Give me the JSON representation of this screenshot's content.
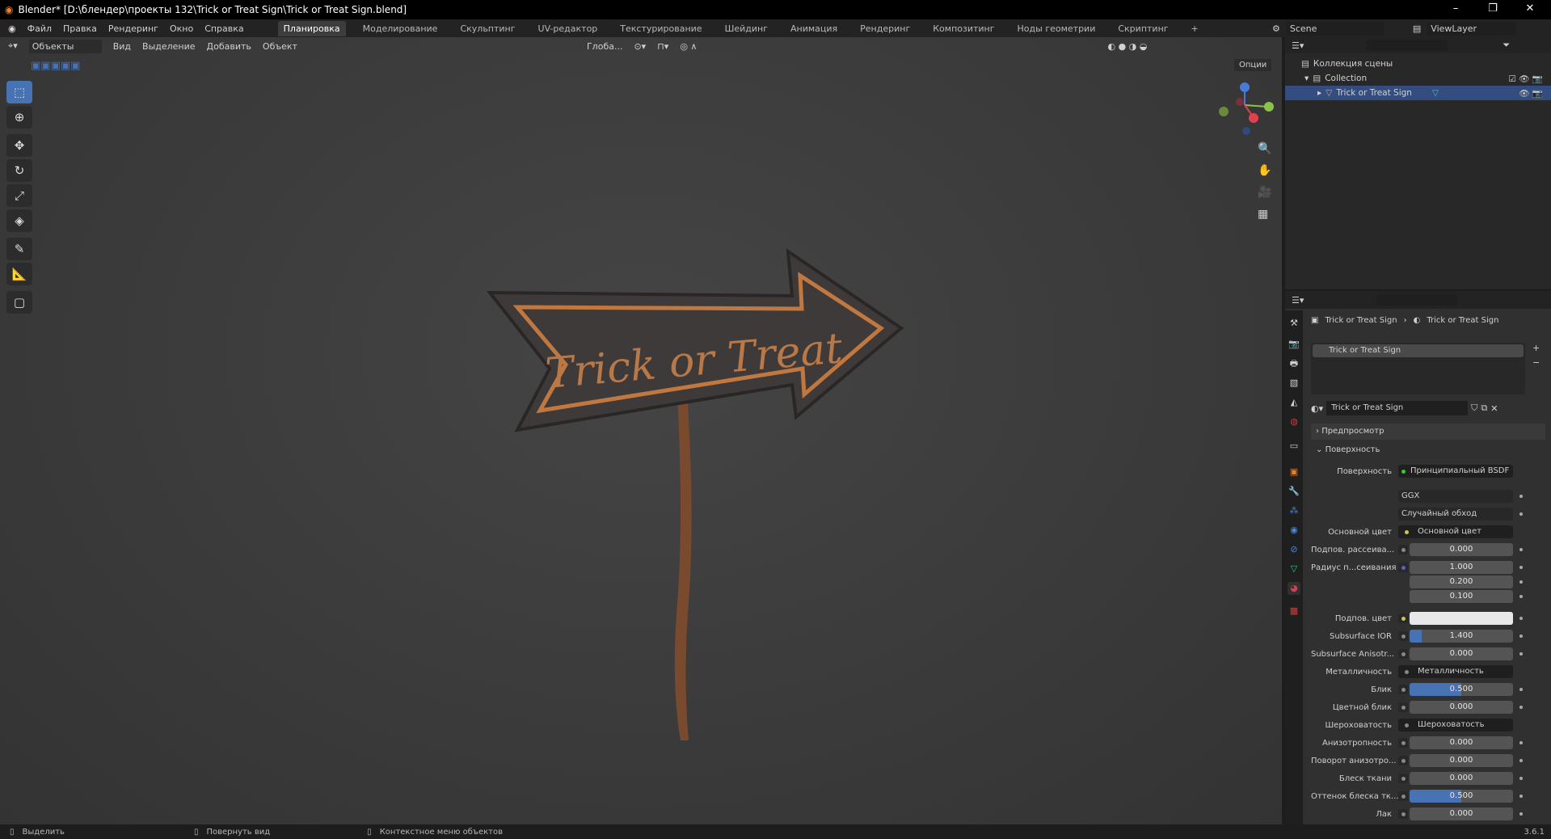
{
  "window": {
    "title": "Blender* [D:\\блендер\\проекты 132\\Trick or Treat Sign\\Trick or Treat Sign.blend]",
    "min": "–",
    "max": "❐",
    "close": "✕"
  },
  "menu": [
    "Файл",
    "Правка",
    "Рендеринг",
    "Окно",
    "Справка"
  ],
  "workspaces": [
    "Планировка",
    "Моделирование",
    "Скульптинг",
    "UV-редактор",
    "Текстурирование",
    "Шейдинг",
    "Анимация",
    "Рендеринг",
    "Композитинг",
    "Ноды геометрии",
    "Скриптинг",
    "+"
  ],
  "scene": "Scene",
  "view_layer": "ViewLayer",
  "viewport": {
    "mode": "Объекты",
    "menus": [
      "Вид",
      "Выделение",
      "Добавить",
      "Объект"
    ],
    "orientation": "Глоба...",
    "options": "Опции",
    "sign_text": "Trick or Treat"
  },
  "outliner": {
    "scene_collection": "Коллекция сцены",
    "collection": "Collection",
    "object": "Trick or Treat Sign"
  },
  "properties": {
    "breadcrumb": [
      "Trick or Treat Sign",
      "Trick or Treat Sign"
    ],
    "slot": "Trick or Treat Sign",
    "material": "Trick or Treat Sign",
    "panels": {
      "preview": "Предпросмотр",
      "surface": "Поверхность"
    },
    "surface_label": "Поверхность",
    "shader": "Принципиальный BSDF",
    "distribution": "GGX",
    "subsurface_method": "Случайный обход",
    "rows": [
      {
        "label": "Основной цвет",
        "link": "Основной цвет",
        "dot": "#c8c850"
      },
      {
        "label": "Подпов. рассеива...",
        "value": "0.000",
        "fill": 0
      },
      {
        "label": "Радиус п...сеивания",
        "values": [
          "1.000",
          "0.200",
          "0.100"
        ],
        "dot": "#6060c0"
      },
      {
        "label": "Подпов. цвет",
        "color": "#e8e8e8",
        "dot": "#c8c850"
      },
      {
        "label": "Subsurface IOR",
        "value": "1.400",
        "fill": 0.12
      },
      {
        "label": "Subsurface Anisotr...",
        "value": "0.000",
        "fill": 0
      },
      {
        "label": "Металличность",
        "link": "Металличность"
      },
      {
        "label": "Блик",
        "value": "0.500",
        "fill": 0.5
      },
      {
        "label": "Цветной блик",
        "value": "0.000",
        "fill": 0
      },
      {
        "label": "Шероховатость",
        "link": "Шероховатость"
      },
      {
        "label": "Анизотропность",
        "value": "0.000",
        "fill": 0
      },
      {
        "label": "Поворот анизотро...",
        "value": "0.000",
        "fill": 0
      },
      {
        "label": "Блеск ткани",
        "value": "0.000",
        "fill": 0
      },
      {
        "label": "Оттенок блеска тк...",
        "value": "0.500",
        "fill": 0.5
      },
      {
        "label": "Лак",
        "value": "0.000",
        "fill": 0
      }
    ]
  },
  "status": {
    "select": "Выделить",
    "rotate": "Повернуть вид",
    "context": "Контекстное меню объектов",
    "version": "3.6.1"
  },
  "colors": {
    "accent": "#4772b3",
    "sign_wood": "#3e3a3a",
    "sign_trim": "#c07840"
  }
}
